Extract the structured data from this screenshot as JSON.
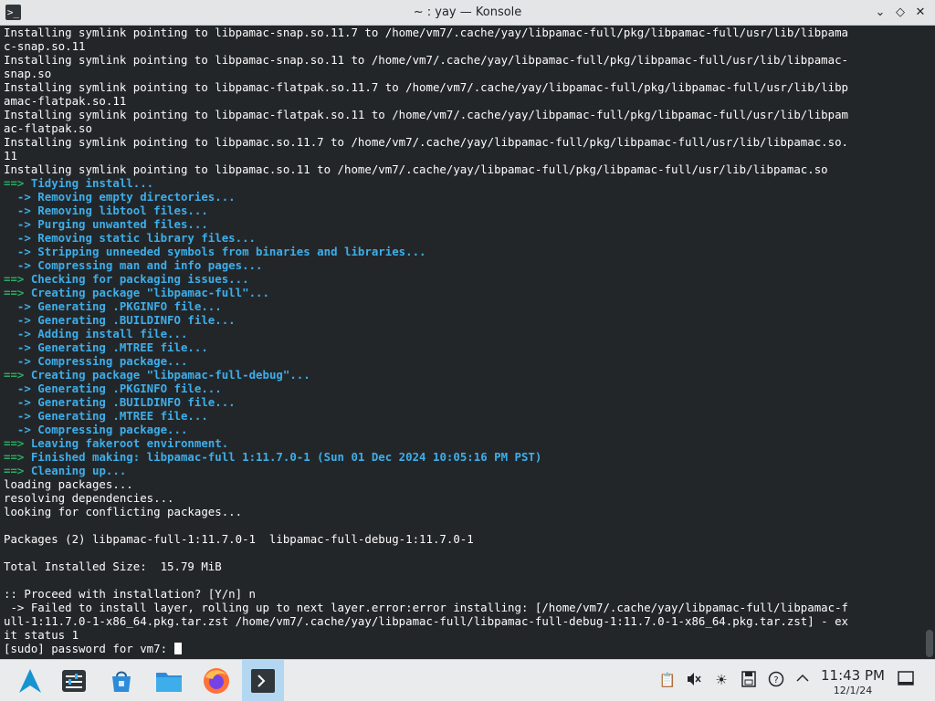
{
  "window": {
    "title": "~ : yay — Konsole",
    "app_icon_glyph": ">_"
  },
  "terminal": {
    "lines": [
      {
        "t": "Installing symlink pointing to libpamac-snap.so.11.7 to /home/vm7/.cache/yay/libpamac-full/pkg/libpamac-full/usr/lib/libpama",
        "s": "white"
      },
      {
        "t": "c-snap.so.11",
        "s": "white"
      },
      {
        "t": "Installing symlink pointing to libpamac-snap.so.11 to /home/vm7/.cache/yay/libpamac-full/pkg/libpamac-full/usr/lib/libpamac-",
        "s": "white"
      },
      {
        "t": "snap.so",
        "s": "white"
      },
      {
        "t": "Installing symlink pointing to libpamac-flatpak.so.11.7 to /home/vm7/.cache/yay/libpamac-full/pkg/libpamac-full/usr/lib/libp",
        "s": "white"
      },
      {
        "t": "amac-flatpak.so.11",
        "s": "white"
      },
      {
        "t": "Installing symlink pointing to libpamac-flatpak.so.11 to /home/vm7/.cache/yay/libpamac-full/pkg/libpamac-full/usr/lib/libpam",
        "s": "white"
      },
      {
        "t": "ac-flatpak.so",
        "s": "white"
      },
      {
        "t": "Installing symlink pointing to libpamac.so.11.7 to /home/vm7/.cache/yay/libpamac-full/pkg/libpamac-full/usr/lib/libpamac.so.",
        "s": "white"
      },
      {
        "t": "11",
        "s": "white"
      },
      {
        "t": "Installing symlink pointing to libpamac.so.11 to /home/vm7/.cache/yay/libpamac-full/pkg/libpamac-full/usr/lib/libpamac.so",
        "s": "white"
      },
      {
        "p": "==>",
        "t": " Tidying install...",
        "s": "green"
      },
      {
        "t": "  -> Removing empty directories...",
        "s": "blue"
      },
      {
        "t": "  -> Removing libtool files...",
        "s": "blue"
      },
      {
        "t": "  -> Purging unwanted files...",
        "s": "blue"
      },
      {
        "t": "  -> Removing static library files...",
        "s": "blue"
      },
      {
        "t": "  -> Stripping unneeded symbols from binaries and libraries...",
        "s": "blue"
      },
      {
        "t": "  -> Compressing man and info pages...",
        "s": "blue"
      },
      {
        "p": "==>",
        "t": " Checking for packaging issues...",
        "s": "green"
      },
      {
        "p": "==>",
        "t": " Creating package \"libpamac-full\"...",
        "s": "green"
      },
      {
        "t": "  -> Generating .PKGINFO file...",
        "s": "blue"
      },
      {
        "t": "  -> Generating .BUILDINFO file...",
        "s": "blue"
      },
      {
        "t": "  -> Adding install file...",
        "s": "blue"
      },
      {
        "t": "  -> Generating .MTREE file...",
        "s": "blue"
      },
      {
        "t": "  -> Compressing package...",
        "s": "blue"
      },
      {
        "p": "==>",
        "t": " Creating package \"libpamac-full-debug\"...",
        "s": "green"
      },
      {
        "t": "  -> Generating .PKGINFO file...",
        "s": "blue"
      },
      {
        "t": "  -> Generating .BUILDINFO file...",
        "s": "blue"
      },
      {
        "t": "  -> Generating .MTREE file...",
        "s": "blue"
      },
      {
        "t": "  -> Compressing package...",
        "s": "blue"
      },
      {
        "p": "==>",
        "t": " Leaving fakeroot environment.",
        "s": "green"
      },
      {
        "p": "==>",
        "t": " Finished making: libpamac-full 1:11.7.0-1 (Sun 01 Dec 2024 10:05:16 PM PST)",
        "s": "green"
      },
      {
        "p": "==>",
        "t": " Cleaning up...",
        "s": "green"
      },
      {
        "t": "loading packages...",
        "s": "white"
      },
      {
        "t": "resolving dependencies...",
        "s": "white"
      },
      {
        "t": "looking for conflicting packages...",
        "s": "white"
      },
      {
        "t": "",
        "s": "white"
      },
      {
        "t": "Packages (2) libpamac-full-1:11.7.0-1  libpamac-full-debug-1:11.7.0-1",
        "s": "white"
      },
      {
        "t": "",
        "s": "white"
      },
      {
        "t": "Total Installed Size:  15.79 MiB",
        "s": "white"
      },
      {
        "t": "",
        "s": "white"
      },
      {
        "t": ":: Proceed with installation? [Y/n] n",
        "s": "white"
      },
      {
        "t": " -> Failed to install layer, rolling up to next layer.error:error installing: [/home/vm7/.cache/yay/libpamac-full/libpamac-f",
        "s": "white"
      },
      {
        "t": "ull-1:11.7.0-1-x86_64.pkg.tar.zst /home/vm7/.cache/yay/libpamac-full/libpamac-full-debug-1:11.7.0-1-x86_64.pkg.tar.zst] - ex",
        "s": "white"
      },
      {
        "t": "it status 1",
        "s": "white"
      },
      {
        "t": "[sudo] password for vm7: ",
        "s": "white",
        "cursor": true
      }
    ]
  },
  "taskbar": {
    "clock_time": "11:43 PM",
    "clock_date": "12/1/24"
  },
  "colors": {
    "terminal_bg": "#232629",
    "prompt_arrow": "#27ae60",
    "highlight_text": "#3daee9"
  }
}
